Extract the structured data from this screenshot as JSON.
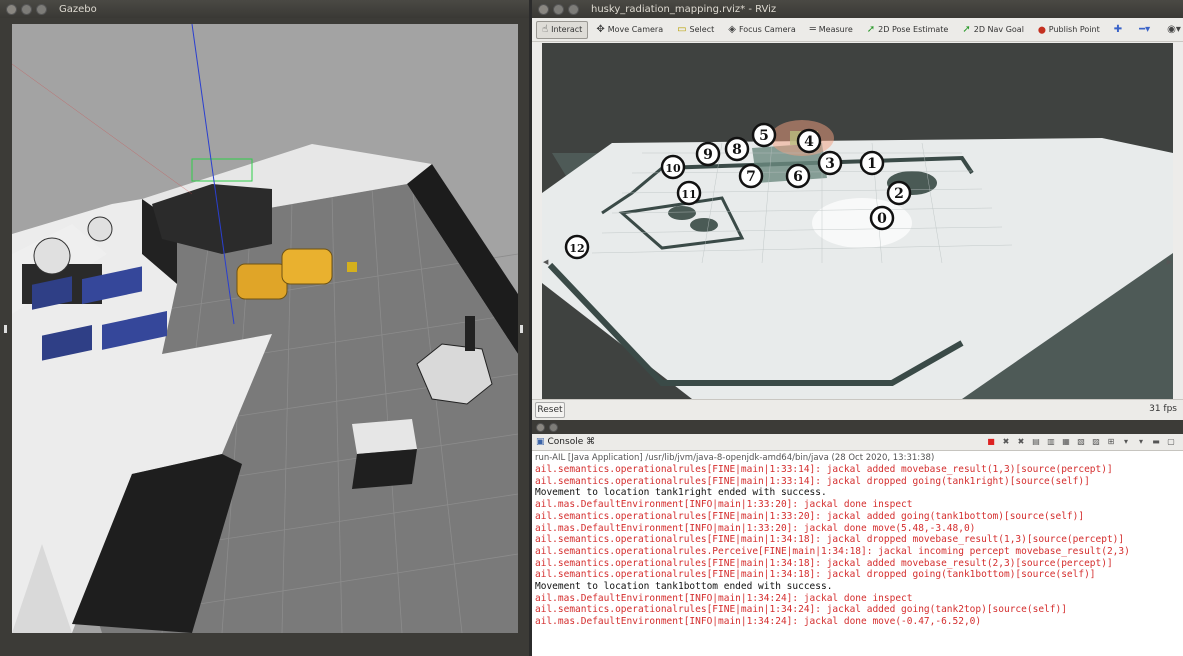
{
  "gazebo": {
    "title": "Gazebo"
  },
  "rviz": {
    "title": "husky_radiation_mapping.rviz* - RViz",
    "toolbar": [
      {
        "label": "Interact",
        "icon": "hand-icon",
        "glyph": "☝",
        "active": true
      },
      {
        "label": "Move Camera",
        "icon": "move-camera-icon",
        "glyph": "✥",
        "active": false
      },
      {
        "label": "Select",
        "icon": "select-icon",
        "glyph": "▭",
        "active": false
      },
      {
        "label": "Focus Camera",
        "icon": "focus-camera-icon",
        "glyph": "◈",
        "active": false
      },
      {
        "label": "Measure",
        "icon": "measure-icon",
        "glyph": "═",
        "active": false
      },
      {
        "label": "2D Pose Estimate",
        "icon": "pose-arrow-icon",
        "glyph": "➚",
        "active": false
      },
      {
        "label": "2D Nav Goal",
        "icon": "nav-goal-arrow-icon",
        "glyph": "➚",
        "active": false
      },
      {
        "label": "Publish Point",
        "icon": "map-pin-icon",
        "glyph": "⬤",
        "active": false
      }
    ],
    "reset_label": "Reset",
    "fps_label": "31 fps",
    "markers": [
      "0",
      "1",
      "2",
      "3",
      "4",
      "5",
      "6",
      "7",
      "8",
      "9",
      "10",
      "11",
      "12"
    ]
  },
  "console": {
    "tab_label": "Console ⌘",
    "meta": "run-AIL [Java Application] /usr/lib/jvm/java-8-openjdk-amd64/bin/java (28 Oct 2020, 13:31:38)",
    "lines": [
      {
        "type": "err",
        "text": "ail.semantics.operationalrules[FINE|main|1:33:14]: jackal added movebase_result(1,3)[source(percept)]"
      },
      {
        "type": "err",
        "text": "ail.semantics.operationalrules[FINE|main|1:33:14]: jackal dropped going(tank1right)[source(self)]"
      },
      {
        "type": "out",
        "text": "Movement to location tank1right ended with success."
      },
      {
        "type": "err",
        "text": "ail.mas.DefaultEnvironment[INFO|main|1:33:20]: jackal done inspect"
      },
      {
        "type": "err",
        "text": "ail.semantics.operationalrules[FINE|main|1:33:20]: jackal added going(tank1bottom)[source(self)]"
      },
      {
        "type": "err",
        "text": "ail.mas.DefaultEnvironment[INFO|main|1:33:20]: jackal done move(5.48,-3.48,0)"
      },
      {
        "type": "err",
        "text": "ail.semantics.operationalrules[FINE|main|1:34:18]: jackal dropped movebase_result(1,3)[source(percept)]"
      },
      {
        "type": "err",
        "text": "ail.semantics.operationalrules.Perceive[FINE|main|1:34:18]: jackal incoming percept movebase_result(2,3)"
      },
      {
        "type": "err",
        "text": "ail.semantics.operationalrules[FINE|main|1:34:18]: jackal added movebase_result(2,3)[source(percept)]"
      },
      {
        "type": "err",
        "text": "ail.semantics.operationalrules[FINE|main|1:34:18]: jackal dropped going(tank1bottom)[source(self)]"
      },
      {
        "type": "out",
        "text": "Movement to location tank1bottom ended with success."
      },
      {
        "type": "err",
        "text": "ail.mas.DefaultEnvironment[INFO|main|1:34:24]: jackal done inspect"
      },
      {
        "type": "err",
        "text": "ail.semantics.operationalrules[FINE|main|1:34:24]: jackal added going(tank2top)[source(self)]"
      },
      {
        "type": "err",
        "text": "ail.mas.DefaultEnvironment[INFO|main|1:34:24]: jackal done move(-0.47,-6.52,0)"
      }
    ]
  },
  "colors": {
    "error_text": "#d42e2e",
    "stdout_text": "#111111",
    "rviz_ground": "#48524f",
    "gazebo_sky": "#a3a3a3"
  }
}
